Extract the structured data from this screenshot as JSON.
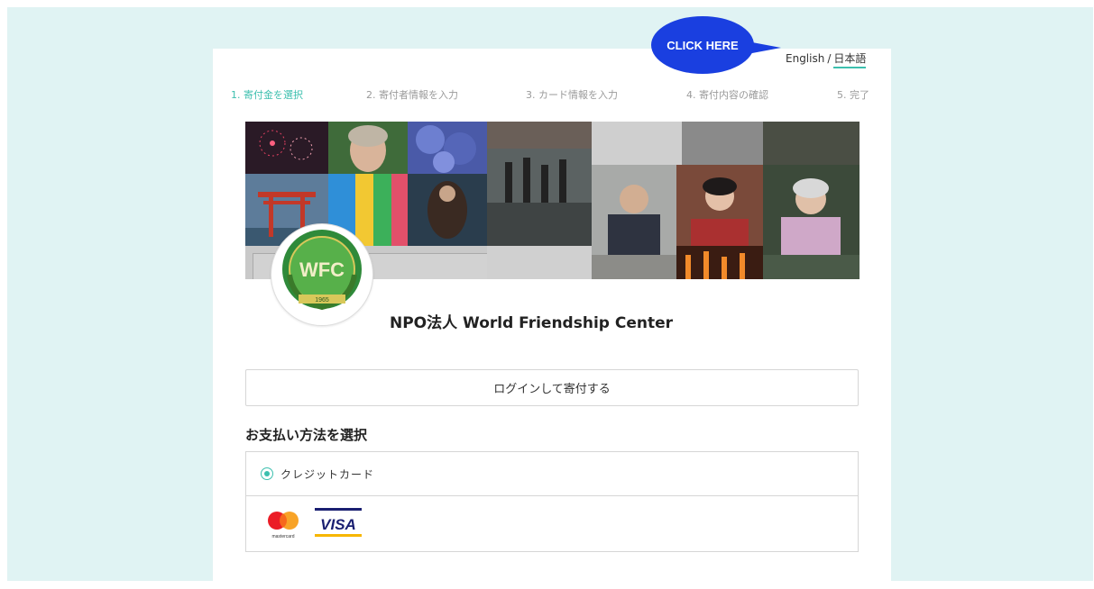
{
  "callout": {
    "label": "CLICK HERE"
  },
  "language_switch": {
    "english": "English",
    "separator": "/",
    "japanese": "日本語",
    "active": "japanese"
  },
  "steps": [
    {
      "label": "1. 寄付金を選択",
      "active": true
    },
    {
      "label": "2. 寄付者情報を入力",
      "active": false
    },
    {
      "label": "3. カード情報を入力",
      "active": false
    },
    {
      "label": "4. 寄付内容の確認",
      "active": false
    },
    {
      "label": "5. 完了",
      "active": false
    }
  ],
  "organization": {
    "name": "NPO法人 World Friendship Center",
    "logo_text": "WFC",
    "logo_year": "1965"
  },
  "login_button": {
    "label": "ログインして寄付する"
  },
  "payment": {
    "title": "お支払い方法を選択",
    "method_label": "クレジットカード",
    "card_brands": [
      "mastercard",
      "VISA"
    ]
  },
  "colors": {
    "accent": "#3cbfae",
    "callout": "#1a3fe0",
    "background": "#e0f3f3"
  }
}
